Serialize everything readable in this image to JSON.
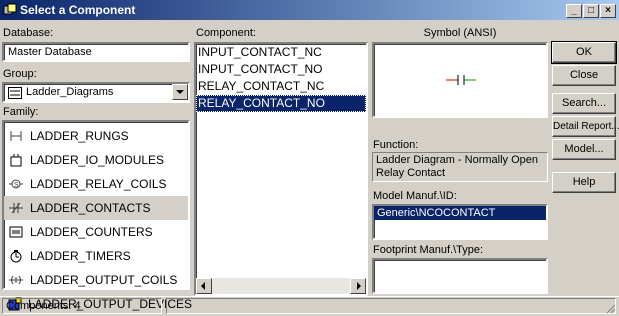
{
  "window": {
    "title": "Select a Component"
  },
  "labels": {
    "database": "Database:",
    "group": "Group:",
    "family": "Family:",
    "component": "Component:",
    "symbol": "Symbol (ANSI)",
    "function": "Function:",
    "model": "Model Manuf.\\ID:",
    "footprint": "Footprint Manuf.\\Type:"
  },
  "database_value": "Master Database",
  "group_value": "Ladder_Diagrams",
  "families": [
    {
      "label": "LADDER_RUNGS",
      "icon": "rungs-icon"
    },
    {
      "label": "LADDER_IO_MODULES",
      "icon": "io-module-icon"
    },
    {
      "label": "LADDER_RELAY_COILS",
      "icon": "relay-coil-icon"
    },
    {
      "label": "LADDER_CONTACTS",
      "icon": "contact-icon"
    },
    {
      "label": "LADDER_COUNTERS",
      "icon": "counter-icon"
    },
    {
      "label": "LADDER_TIMERS",
      "icon": "timer-icon"
    },
    {
      "label": "LADDER_OUTPUT_COILS",
      "icon": "output-coil-icon"
    },
    {
      "label": "LADDER_OUTPUT_DEVICES",
      "icon": "output-device-icon"
    }
  ],
  "components": [
    "INPUT_CONTACT_NC",
    "INPUT_CONTACT_NO",
    "RELAY_CONTACT_NC",
    "RELAY_CONTACT_NO"
  ],
  "selected_component": "RELAY_CONTACT_NO",
  "function_text": "Ladder Diagram - Normally Open Relay Contact",
  "model_value": "Generic\\NCOCONTACT",
  "footprint_value": "",
  "buttons": {
    "ok": "OK",
    "close": "Close",
    "search": "Search...",
    "detail": "Detail Report...",
    "model": "Model...",
    "help": "Help"
  },
  "status": {
    "text": "Components: 4"
  },
  "colors": {
    "selection": "#0a246a",
    "face": "#d4d0c8",
    "symbol_red": "#e00000",
    "symbol_green": "#00a000"
  }
}
